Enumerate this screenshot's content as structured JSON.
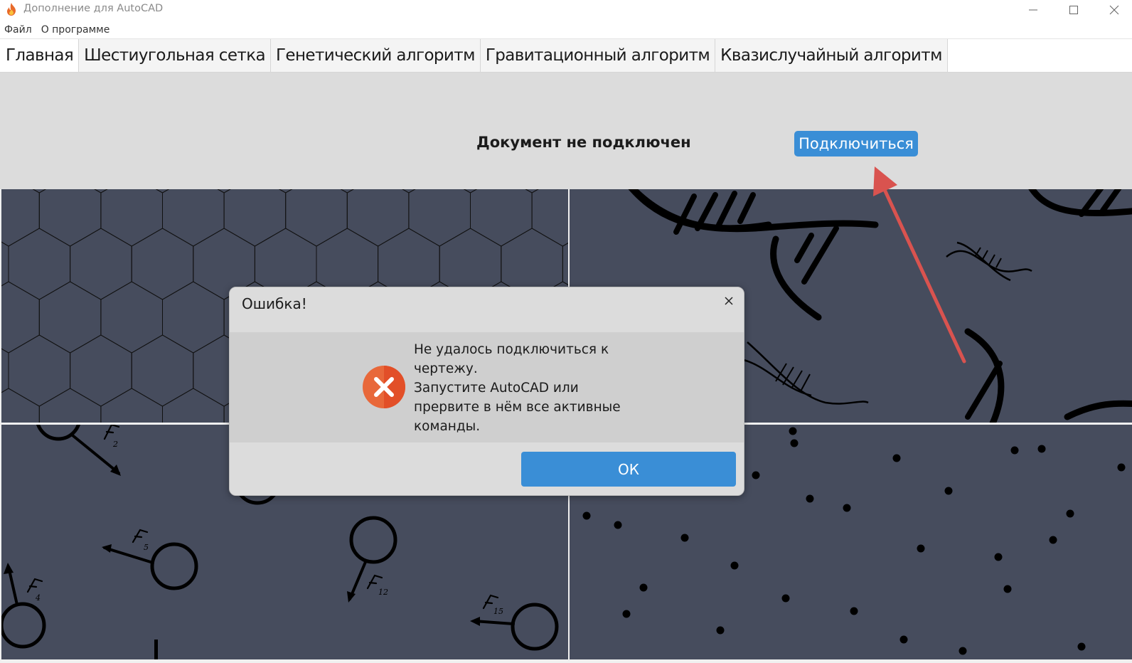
{
  "window": {
    "title": "Дополнение для AutoCAD",
    "icon": "flame-icon"
  },
  "menu": {
    "items": [
      "Файл",
      "О программе"
    ]
  },
  "tabs": [
    {
      "label": "Главная",
      "active": true
    },
    {
      "label": "Шестиугольная сетка",
      "active": false
    },
    {
      "label": "Генетический алгоритм",
      "active": false
    },
    {
      "label": "Гравитационный алгоритм",
      "active": false
    },
    {
      "label": "Квазислучайный алгоритм",
      "active": false
    }
  ],
  "main": {
    "status_text": "Документ не подключен",
    "connect_label": "Подключиться"
  },
  "dialog": {
    "title": "Ошибка!",
    "message_lines": [
      "Не удалось подключиться к",
      "чертежу.",
      "Запустите AutoCAD или",
      "прервите в нём все активные",
      "команды."
    ],
    "ok_label": "ОК",
    "icon": "error-icon"
  },
  "colors": {
    "accent": "#3a8ed6",
    "tile_bg": "#464c5d",
    "arrow": "#d9534f",
    "error_icon": "#e8683a"
  }
}
